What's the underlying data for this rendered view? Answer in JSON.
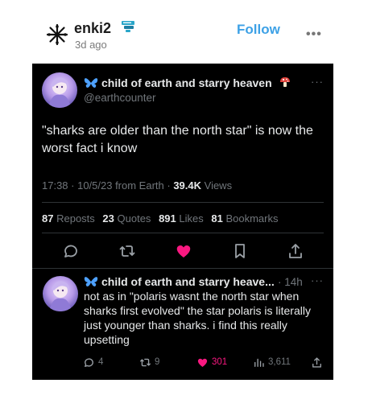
{
  "post": {
    "username": "enki2",
    "time_ago": "3d ago",
    "follow_label": "Follow"
  },
  "tweet": {
    "display_name": "child of earth and starry heaven",
    "handle": "@earthcounter",
    "text": "\"sharks are older than the north star\" is now the worst fact i know",
    "meta_time": "17:38 · 10/5/23 from Earth · ",
    "views_count": "39.4K",
    "views_label": " Views",
    "stats": [
      {
        "count": "87",
        "label": "Reposts"
      },
      {
        "count": "23",
        "label": "Quotes"
      },
      {
        "count": "891",
        "label": "Likes"
      },
      {
        "count": "81",
        "label": "Bookmarks"
      }
    ]
  },
  "reply": {
    "display_name": "child of earth and starry heave...",
    "time": "· 14h",
    "text": "not as in \"polaris wasnt the north star when sharks first evolved\" the star polaris is literally just younger than sharks. i find this really upsetting",
    "replies": "4",
    "reposts": "9",
    "likes": "301",
    "views": "3,611"
  },
  "colors": {
    "follow": "#3da1e6",
    "like": "#f91880",
    "butterfly": "#4ea1ff"
  }
}
